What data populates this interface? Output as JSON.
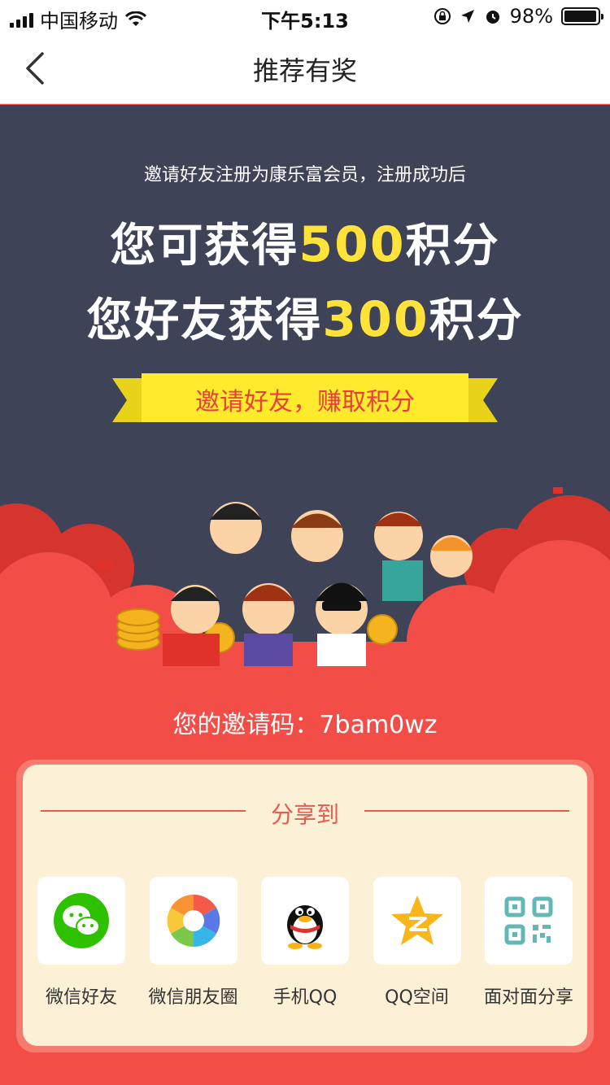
{
  "status_bar": {
    "carrier": "中国移动",
    "time": "下午5:13",
    "battery": "98%",
    "battery_level": 0.98
  },
  "nav": {
    "title": "推荐有奖",
    "back_icon": "chevron-left-icon"
  },
  "hero": {
    "subtitle": "邀请好友注册为康乐富会员，注册成功后",
    "line1_prefix": "您可获得",
    "line1_points": "500",
    "line1_suffix": "积分",
    "line2_prefix": "您好友获得",
    "line2_points": "300",
    "line2_suffix": "积分",
    "ribbon_text": "邀请好友，赚取积分"
  },
  "invite": {
    "text": "您的邀请码：7bam0wz"
  },
  "share": {
    "title": "分享到",
    "items": [
      {
        "label": "微信好友",
        "icon": "wechat-icon"
      },
      {
        "label": "微信朋友圈",
        "icon": "wechat-moments-icon"
      },
      {
        "label": "手机QQ",
        "icon": "qq-icon"
      },
      {
        "label": "QQ空间",
        "icon": "qzone-icon"
      },
      {
        "label": "面对面分享",
        "icon": "qr-code-icon"
      }
    ]
  },
  "colors": {
    "hero_bg": "#3e4358",
    "accent_red": "#f24d47",
    "highlight_yellow": "#ffe33b",
    "card_bg": "#fcf1d7"
  }
}
